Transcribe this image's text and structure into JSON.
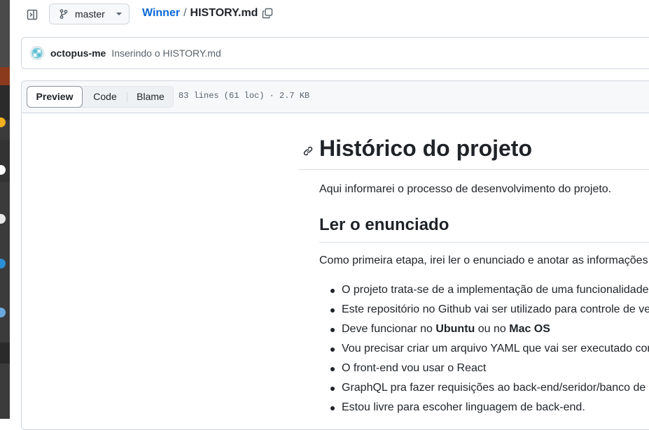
{
  "header": {
    "sidebar_toggle_icon": "sidebar-expand-icon",
    "branch": {
      "icon": "git-branch-icon",
      "label": "master"
    },
    "breadcrumb": {
      "repo": "Winner",
      "separator": "/",
      "file": "HISTORY.md",
      "copy_icon": "copy-icon"
    }
  },
  "commit": {
    "author": "octopus-me",
    "message": "Inserindo o HISTORY.md"
  },
  "file_header": {
    "tabs": [
      "Preview",
      "Code",
      "Blame"
    ],
    "active_tab": "Preview",
    "meta": "83 lines (61 loc) · 2.7 KB"
  },
  "markdown": {
    "h1": "Histórico do projeto",
    "intro": "Aqui informarei o processo de desenvolvimento do projeto.",
    "h2": "Ler o enunciado",
    "p2": "Como primeira etapa, irei ler o enunciado e anotar as informações impe",
    "items": [
      {
        "text": "O projeto trata-se de a implementação de uma funcionalidade de a"
      },
      {
        "text": "Este repositório no Github vai ser utilizado para controle de version"
      },
      {
        "pre": "Deve funcionar no ",
        "b1": "Ubuntu",
        "mid": " ou no ",
        "b2": "Mac OS"
      },
      {
        "text": "Vou precisar criar um arquivo YAML que vai ser executado com o c"
      },
      {
        "text": "O front-end vou usar o React"
      },
      {
        "text": "GraphQL pra fazer requisições ao back-end/seridor/banco de dado"
      },
      {
        "text": "Estou livre para escoher linguagem de back-end."
      }
    ]
  },
  "colors": {
    "link": "#0969da",
    "text": "#1f2328",
    "muted": "#59636e",
    "border": "#d0d7de"
  }
}
